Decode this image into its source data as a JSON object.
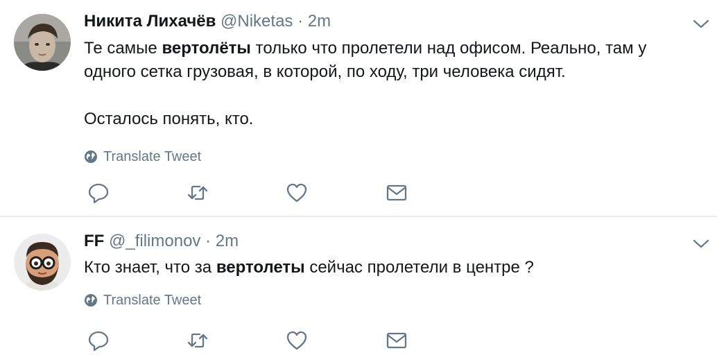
{
  "tweets": [
    {
      "author_name": "Никита Лихачёв",
      "handle": "@Niketas",
      "separator": "·",
      "time": "2m",
      "text_plain_1": "Те самые ",
      "text_bold": "вертолёты",
      "text_plain_2": " только что пролетели над офисом. Реально, там у одного сетка грузовая, в которой, по ходу, три человека сидят.",
      "text_paragraph_2": "Осталось понять, кто.",
      "translate_label": "Translate Tweet"
    },
    {
      "author_name": "FF",
      "handle": "@_filimonov",
      "separator": "·",
      "time": "2m",
      "text_plain_1": "Кто знает, что за ",
      "text_bold": "вертолеты",
      "text_plain_2": " сейчас пролетели в центре ?",
      "translate_label": "Translate Tweet"
    }
  ],
  "icons": {
    "reply": "reply-icon",
    "retweet": "retweet-icon",
    "like": "like-icon",
    "dm": "direct-message-icon",
    "globe": "globe-icon",
    "caret": "chevron-down-icon"
  },
  "colors": {
    "text": "#14171a",
    "secondary": "#657786",
    "divider": "#e6ecf0"
  }
}
